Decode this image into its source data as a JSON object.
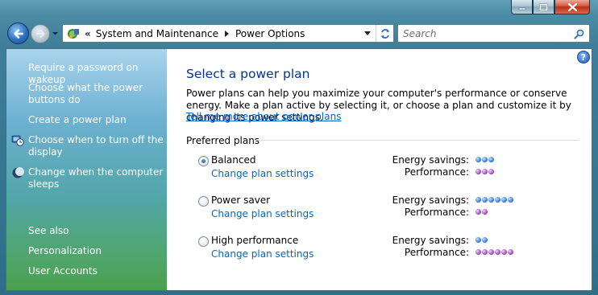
{
  "window": {
    "caption_buttons": [
      {
        "name": "minimize-button",
        "icon": "minimize-icon"
      },
      {
        "name": "maximize-button",
        "icon": "maximize-icon"
      },
      {
        "name": "close-button",
        "icon": "close-icon"
      }
    ]
  },
  "toolbar": {
    "back_icon": "back-arrow-icon",
    "forward_icon": "forward-arrow-icon",
    "address": {
      "icon": "control-panel-icon",
      "overflow": "«",
      "breadcrumbs": [
        "System and Maintenance",
        "Power Options"
      ]
    },
    "search": {
      "placeholder": "Search",
      "icon": "search-icon"
    }
  },
  "sidebar": {
    "tasks": [
      {
        "label": "Require a password on wakeup",
        "icon": ""
      },
      {
        "label": "Choose what the power buttons do",
        "icon": ""
      },
      {
        "label": "Create a power plan",
        "icon": ""
      },
      {
        "label": "Choose when to turn off the display",
        "icon": "display-timer-icon"
      },
      {
        "label": "Change when the computer sleeps",
        "icon": "sleep-moon-icon"
      }
    ],
    "see_also_heading": "See also",
    "see_also": [
      {
        "label": "Personalization"
      },
      {
        "label": "User Accounts"
      }
    ]
  },
  "main": {
    "help_label": "?",
    "title": "Select a power plan",
    "intro": "Power plans can help you maximize your computer's performance or conserve energy. Make a plan active by selecting it, or choose a plan and customize it by changing its power settings.",
    "intro_link": "Tell me more about power plans",
    "group_label": "Preferred plans",
    "energy_label": "Energy savings:",
    "performance_label": "Performance:",
    "plans": [
      {
        "name": "Balanced",
        "selected": true,
        "link": "Change plan settings",
        "energy_savings": 3,
        "performance": 3
      },
      {
        "name": "Power saver",
        "selected": false,
        "link": "Change plan settings",
        "energy_savings": 6,
        "performance": 2
      },
      {
        "name": "High performance",
        "selected": false,
        "link": "Change plan settings",
        "energy_savings": 2,
        "performance": 6
      }
    ]
  },
  "colors": {
    "link": "#0066cc",
    "title": "#003399",
    "energy_dot": "#3a7fd8",
    "performance_dot": "#a24fbf"
  }
}
